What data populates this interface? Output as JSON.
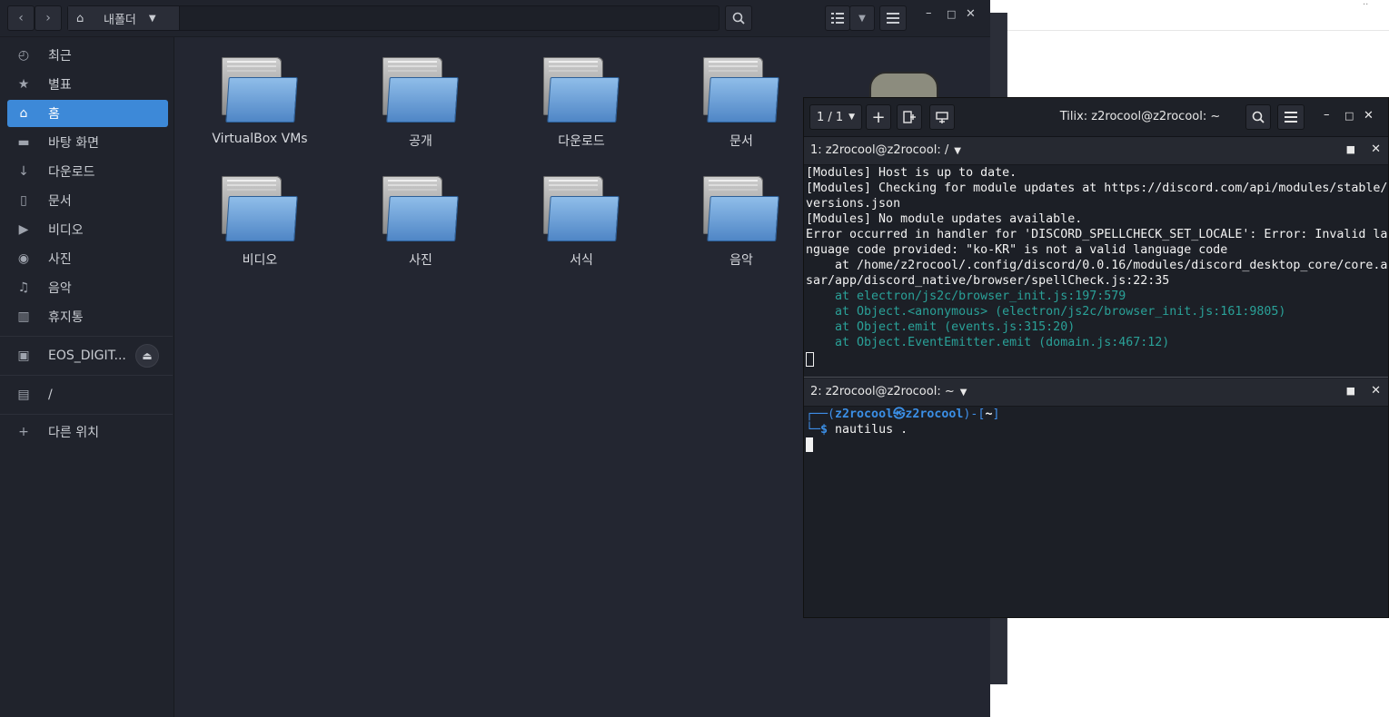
{
  "file_manager": {
    "path_location": "내폴더",
    "sidebar": {
      "items": [
        {
          "icon": "clock-icon",
          "label": "최근"
        },
        {
          "icon": "star-icon",
          "label": "별표"
        },
        {
          "icon": "home-icon",
          "label": "홈",
          "active": true
        },
        {
          "icon": "folder-icon",
          "label": "바탕 화면"
        },
        {
          "icon": "download-icon",
          "label": "다운로드"
        },
        {
          "icon": "document-icon",
          "label": "문서"
        },
        {
          "icon": "video-icon",
          "label": "비디오"
        },
        {
          "icon": "camera-icon",
          "label": "사진"
        },
        {
          "icon": "music-icon",
          "label": "음악"
        },
        {
          "icon": "trash-icon",
          "label": "휴지통"
        }
      ],
      "devices": [
        {
          "icon": "drive-icon",
          "label": "EOS_DIGIT..."
        },
        {
          "icon": "computer-icon",
          "label": "/"
        }
      ],
      "other_locations": "다른 위치"
    },
    "folders": [
      "VirtualBox VMs",
      "공개",
      "다운로드",
      "문서",
      "비디오",
      "사진",
      "서식",
      "음악"
    ]
  },
  "terminal": {
    "session_counter": "1 / 1",
    "title": "Tilix: z2rocool@z2rocool: ~",
    "pane1": {
      "title": "1: z2rocool@z2rocool: /",
      "lines": [
        "[Modules] Host is up to date.",
        "[Modules] Checking for module updates at https://discord.com/api/modules/stable/",
        "versions.json",
        "[Modules] No module updates available.",
        "Error occurred in handler for 'DISCORD_SPELLCHECK_SET_LOCALE': Error: Invalid la",
        "nguage code provided: \"ko-KR\" is not a valid language code",
        "    at /home/z2rocool/.config/discord/0.0.16/modules/discord_desktop_core/core.a",
        "sar/app/discord_native/browser/spellCheck.js:22:35"
      ],
      "stack_lines": [
        "    at electron/js2c/browser_init.js:197:579",
        "    at Object.<anonymous> (electron/js2c/browser_init.js:161:9805)",
        "    at Object.emit (events.js:315:20)",
        "    at Object.EventEmitter.emit (domain.js:467:12)"
      ]
    },
    "pane2": {
      "title": "2: z2rocool@z2rocool: ~",
      "prompt_open": "┌──(",
      "user": "z2rocool",
      "at": "㉿",
      "host": "z2rocool",
      "prompt_mid": ")-[",
      "dir": "~",
      "prompt_close": "]",
      "prompt_line2": "└─",
      "dollar": "$",
      "command": " nautilus ."
    }
  }
}
